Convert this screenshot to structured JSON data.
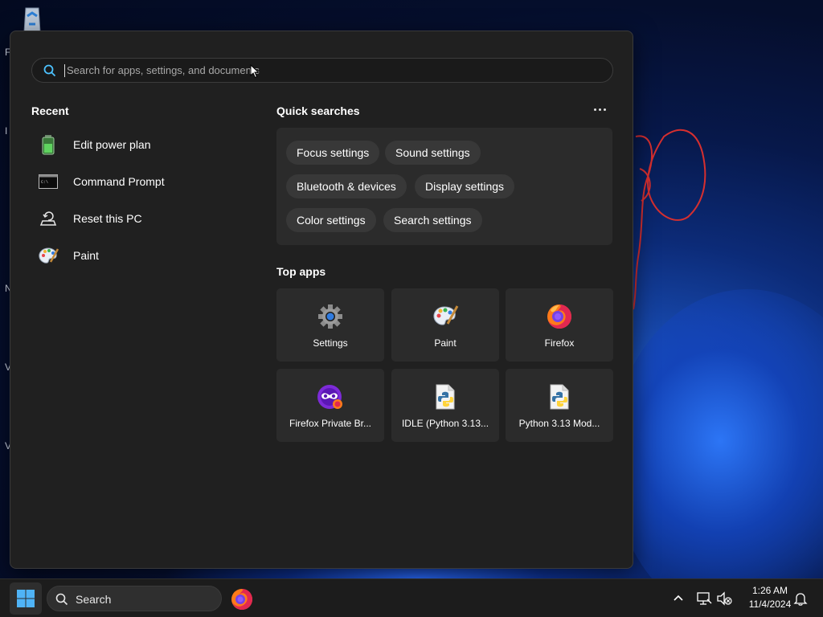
{
  "search": {
    "placeholder": "Search for apps, settings, and documents"
  },
  "recent": {
    "title": "Recent",
    "items": [
      {
        "label": "Edit power plan",
        "icon": "battery-icon"
      },
      {
        "label": "Command Prompt",
        "icon": "terminal-icon"
      },
      {
        "label": "Reset this PC",
        "icon": "reset-pc-icon"
      },
      {
        "label": "Paint",
        "icon": "paint-palette-icon"
      }
    ]
  },
  "quick_searches": {
    "title": "Quick searches",
    "items": [
      "Focus settings",
      "Sound settings",
      "Bluetooth & devices",
      "Display settings",
      "Color settings",
      "Search settings"
    ]
  },
  "top_apps": {
    "title": "Top apps",
    "items": [
      {
        "label": "Settings",
        "icon": "gear-icon"
      },
      {
        "label": "Paint",
        "icon": "paint-palette-icon"
      },
      {
        "label": "Firefox",
        "icon": "firefox-icon"
      },
      {
        "label": "Firefox Private Br...",
        "icon": "firefox-private-icon"
      },
      {
        "label": "IDLE (Python 3.13...",
        "icon": "python-file-icon"
      },
      {
        "label": "Python 3.13 Mod...",
        "icon": "python-file-icon"
      }
    ]
  },
  "taskbar": {
    "search_label": "Search",
    "time": "1:26 AM",
    "date": "11/4/2024"
  },
  "colors": {
    "menu_bg": "#202020",
    "panel_bg": "#2b2b2b",
    "chip_bg": "#383838",
    "taskbar_bg": "#1c1c1c",
    "accent": "#4cc2ff"
  }
}
